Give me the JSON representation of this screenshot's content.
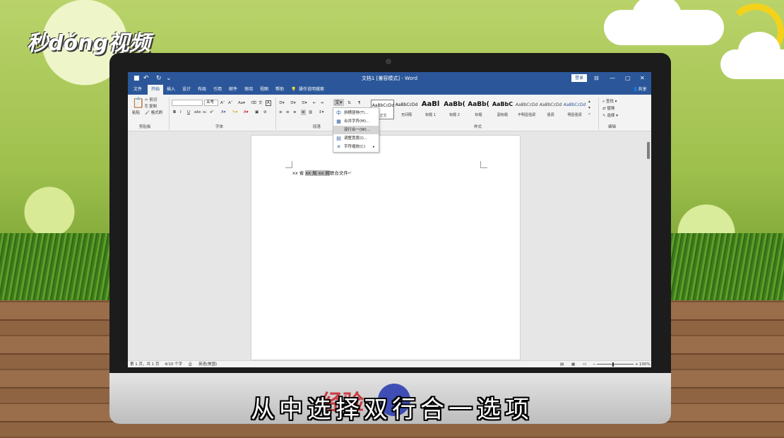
{
  "logo": "秒dǒng视频",
  "subtitle": "从中选择双行合一选项",
  "watermark": "经验",
  "word": {
    "title": "文档1 [兼容模式] - Word",
    "login": "登录",
    "quick_access": [
      "save-icon",
      "undo-icon",
      "redo-icon"
    ],
    "menu_tabs": [
      "文件",
      "开始",
      "插入",
      "设计",
      "布局",
      "引用",
      "邮件",
      "审阅",
      "视图",
      "帮助"
    ],
    "active_tab": "开始",
    "tell_me": "操作说明搜索",
    "share": "共享",
    "clipboard": {
      "paste": "粘贴",
      "cut": "剪切",
      "copy": "复制",
      "format_painter": "格式刷",
      "group_label": "剪贴板"
    },
    "font": {
      "size": "五号",
      "group_label": "字体"
    },
    "paragraph": {
      "group_label": "段落"
    },
    "styles": {
      "items": [
        {
          "sample": "AaBbCcDd",
          "name": "正文"
        },
        {
          "sample": "AaBbCcDd",
          "name": "无间隔"
        },
        {
          "sample": "AaBl",
          "name": "标题 1"
        },
        {
          "sample": "AaBb(",
          "name": "标题 2"
        },
        {
          "sample": "AaBb(",
          "name": "标题"
        },
        {
          "sample": "AaBbC",
          "name": "副标题"
        },
        {
          "sample": "AaBbCcDd",
          "name": "不明显强调"
        },
        {
          "sample": "AaBbCcDd",
          "name": "强调"
        },
        {
          "sample": "AaBbCcDd",
          "name": "明显强调"
        }
      ],
      "group_label": "样式"
    },
    "editing": {
      "find": "查找",
      "replace": "替换",
      "select": "选择",
      "group_label": "编辑"
    },
    "dropdown": [
      {
        "icon": "中",
        "label": "拼横竖排(T)..."
      },
      {
        "icon": "▦",
        "label": "合并字符(M)..."
      },
      {
        "icon": "",
        "label": "双行合一(W)..."
      },
      {
        "icon": "▤",
        "label": "调整宽度(I)..."
      },
      {
        "icon": "✕",
        "label": "字符缩放(C)"
      }
    ],
    "document": {
      "before": "xx 省 ",
      "highlight": "xx 局 xx 局",
      "after": "联合文件",
      "para_mark": "↵"
    },
    "status": {
      "page": "第 1 页，共 1 页",
      "words": "4/10 个字",
      "language": "英语(美国)",
      "zoom": "100%"
    }
  }
}
